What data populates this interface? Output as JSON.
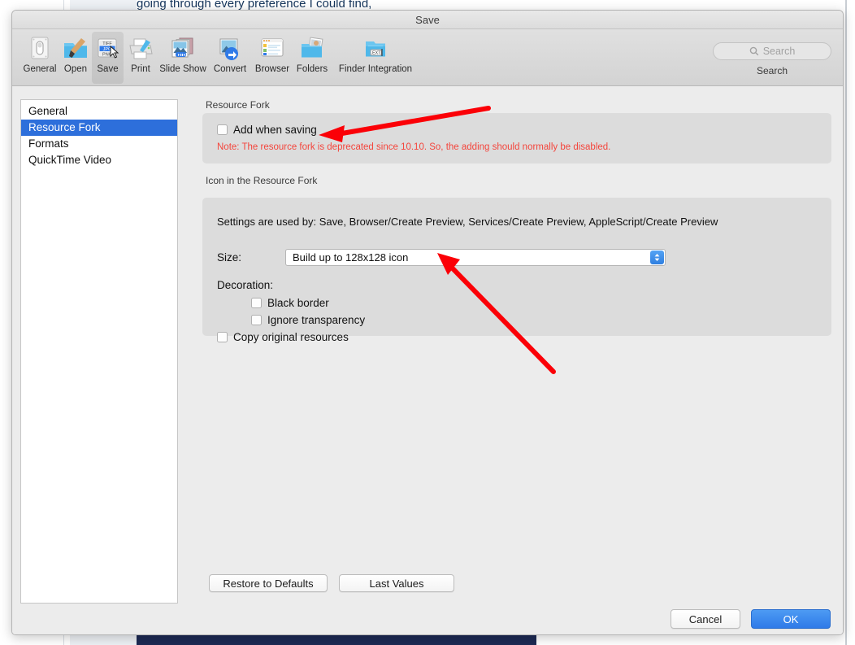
{
  "background": {
    "text_line": "going through every preference I could find,"
  },
  "window": {
    "title": "Save"
  },
  "toolbar": {
    "items": [
      {
        "label": "General",
        "icon": "general-icon",
        "selected": false
      },
      {
        "label": "Open",
        "icon": "open-folder-brush-icon",
        "selected": false
      },
      {
        "label": "Save",
        "icon": "save-formats-icon",
        "selected": true
      },
      {
        "label": "Print",
        "icon": "printer-icon",
        "selected": false
      },
      {
        "label": "Slide Show",
        "icon": "slideshow-icon",
        "selected": false
      },
      {
        "label": "Convert",
        "icon": "convert-arrow-icon",
        "selected": false
      },
      {
        "label": "Browser",
        "icon": "browser-window-icon",
        "selected": false
      },
      {
        "label": "Folders",
        "icon": "folders-photo-icon",
        "selected": false
      },
      {
        "label": "Finder Integration",
        "icon": "finder-integration-icon",
        "selected": false
      }
    ],
    "save_icon_formats": [
      "TIFF",
      "JPG",
      "PNG"
    ],
    "finder_ext_badge": ".EXT"
  },
  "search": {
    "placeholder": "Search",
    "value": "",
    "label": "Search",
    "icon": "search-icon"
  },
  "sidebar": {
    "items": [
      {
        "label": "General",
        "selected": false
      },
      {
        "label": "Resource Fork",
        "selected": true
      },
      {
        "label": "Formats",
        "selected": false
      },
      {
        "label": "QuickTime Video",
        "selected": false
      }
    ]
  },
  "resource_fork_group": {
    "title": "Resource Fork",
    "add_when_saving": {
      "label": "Add when saving",
      "checked": false
    },
    "note": "Note: The resource fork is deprecated since 10.10. So, the adding should normally be disabled."
  },
  "icon_group": {
    "title": "Icon in the Resource Fork",
    "settings_used_by": "Settings are used by: Save, Browser/Create Preview, Services/Create Preview, AppleScript/Create Preview",
    "size_label": "Size:",
    "size_value": "Build up to 128x128 icon",
    "decoration_label": "Decoration:",
    "checkboxes": [
      {
        "label": "Black border",
        "checked": false
      },
      {
        "label": "Ignore transparency",
        "checked": false
      }
    ],
    "copy_original": {
      "label": "Copy original resources",
      "checked": false
    }
  },
  "content_buttons": {
    "restore": "Restore to Defaults",
    "last_values": "Last Values"
  },
  "footer": {
    "cancel": "Cancel",
    "ok": "OK"
  },
  "colors": {
    "accent_blue": "#2d6fdb",
    "default_button_blue": "#2f7ae8",
    "note_red": "#f4453c",
    "annotation_red": "#fb0007",
    "window_bg": "#ececec",
    "group_bg": "#dcdcdc"
  },
  "annotations": {
    "arrow_1": {
      "name": "arrow-to-add-when-saving",
      "color": "#fb0007"
    },
    "arrow_2": {
      "name": "arrow-to-size-popup",
      "color": "#fb0007"
    }
  }
}
